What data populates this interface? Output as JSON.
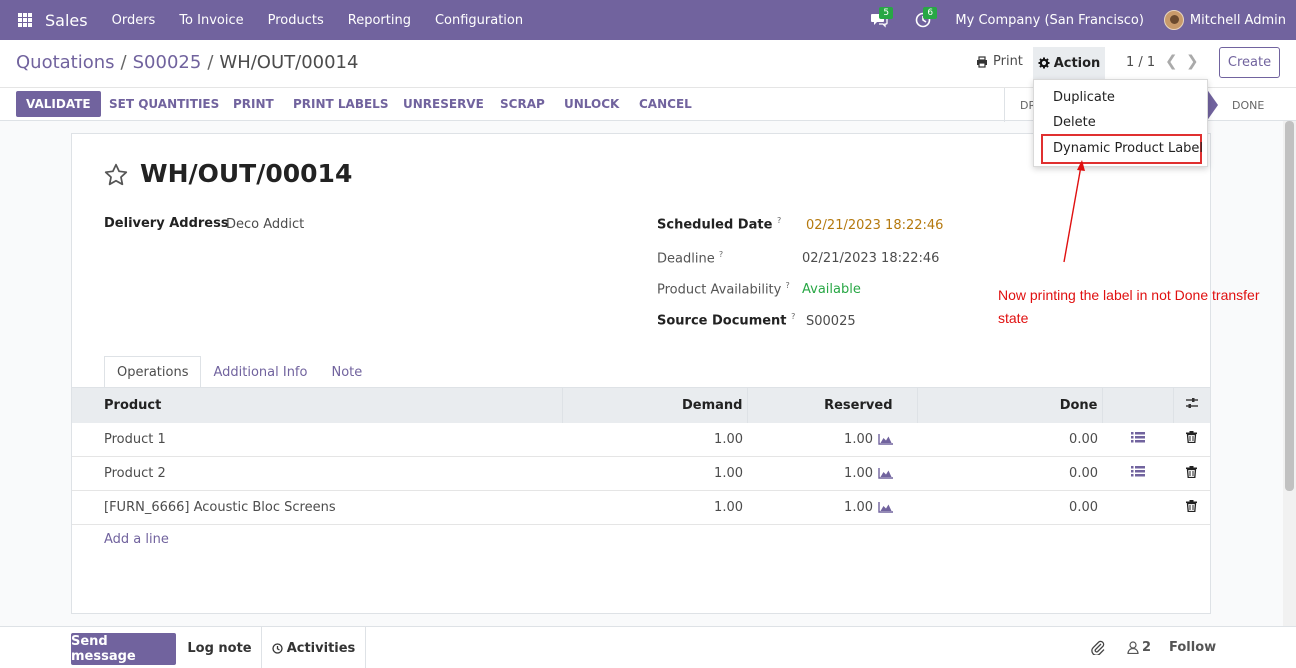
{
  "navbar": {
    "app_name": "Sales",
    "menu": [
      "Orders",
      "To Invoice",
      "Products",
      "Reporting",
      "Configuration"
    ],
    "messages_count": "5",
    "activities_count": "6",
    "company": "My Company (San Francisco)",
    "user": "Mitchell Admin"
  },
  "breadcrumb": {
    "items": [
      "Quotations",
      "S00025"
    ],
    "current": "WH/OUT/00014",
    "separator": "/"
  },
  "controls": {
    "print_label": "Print",
    "action_label": "Action",
    "pager": "1 / 1",
    "create_label": "Create"
  },
  "action_menu": {
    "items": [
      "Duplicate",
      "Delete",
      "Dynamic Product Label"
    ]
  },
  "statusbar": {
    "buttons": [
      "VALIDATE",
      "SET QUANTITIES",
      "PRINT",
      "PRINT LABELS",
      "UNRESERVE",
      "SCRAP",
      "UNLOCK",
      "CANCEL"
    ],
    "states": [
      "DR",
      "DONE"
    ]
  },
  "record": {
    "title": "WH/OUT/00014",
    "fields": {
      "delivery_address_label": "Delivery Address",
      "delivery_address": "Deco Addict",
      "scheduled_date_label": "Scheduled Date",
      "scheduled_date": "02/21/2023 18:22:46",
      "deadline_label": "Deadline",
      "deadline": "02/21/2023 18:22:46",
      "availability_label": "Product Availability",
      "availability": "Available",
      "source_label": "Source Document",
      "source": "S00025",
      "help_mark": "?"
    }
  },
  "tabs": [
    "Operations",
    "Additional Info",
    "Note"
  ],
  "operations": {
    "columns": [
      "Product",
      "Demand",
      "Reserved",
      "Done"
    ],
    "rows": [
      {
        "product": "Product 1",
        "demand": "1.00",
        "reserved": "1.00",
        "done": "0.00",
        "details": true
      },
      {
        "product": "Product 2",
        "demand": "1.00",
        "reserved": "1.00",
        "done": "0.00",
        "details": true
      },
      {
        "product": "[FURN_6666] Acoustic Bloc Screens",
        "demand": "1.00",
        "reserved": "1.00",
        "done": "0.00",
        "details": false
      }
    ],
    "add_line": "Add a line"
  },
  "annotation": {
    "text": "Now printing the label in not Done transfer state",
    "color": "#e01010"
  },
  "chatter": {
    "send_message": "Send message",
    "log_note": "Log note",
    "activities": "Activities",
    "followers_count": "2",
    "follow": "Follow"
  },
  "colors": {
    "brand": "#71639e",
    "available": "#28a745",
    "scheduled_date": "#b5790e"
  },
  "icons": [
    "apps-icon",
    "chat-icon",
    "clock-icon",
    "print-icon",
    "gear-icon",
    "chevron-left-icon",
    "chevron-right-icon",
    "star-icon",
    "forecast-icon",
    "details-list-icon",
    "trash-icon",
    "sliders-icon",
    "paperclip-icon",
    "user-icon"
  ]
}
